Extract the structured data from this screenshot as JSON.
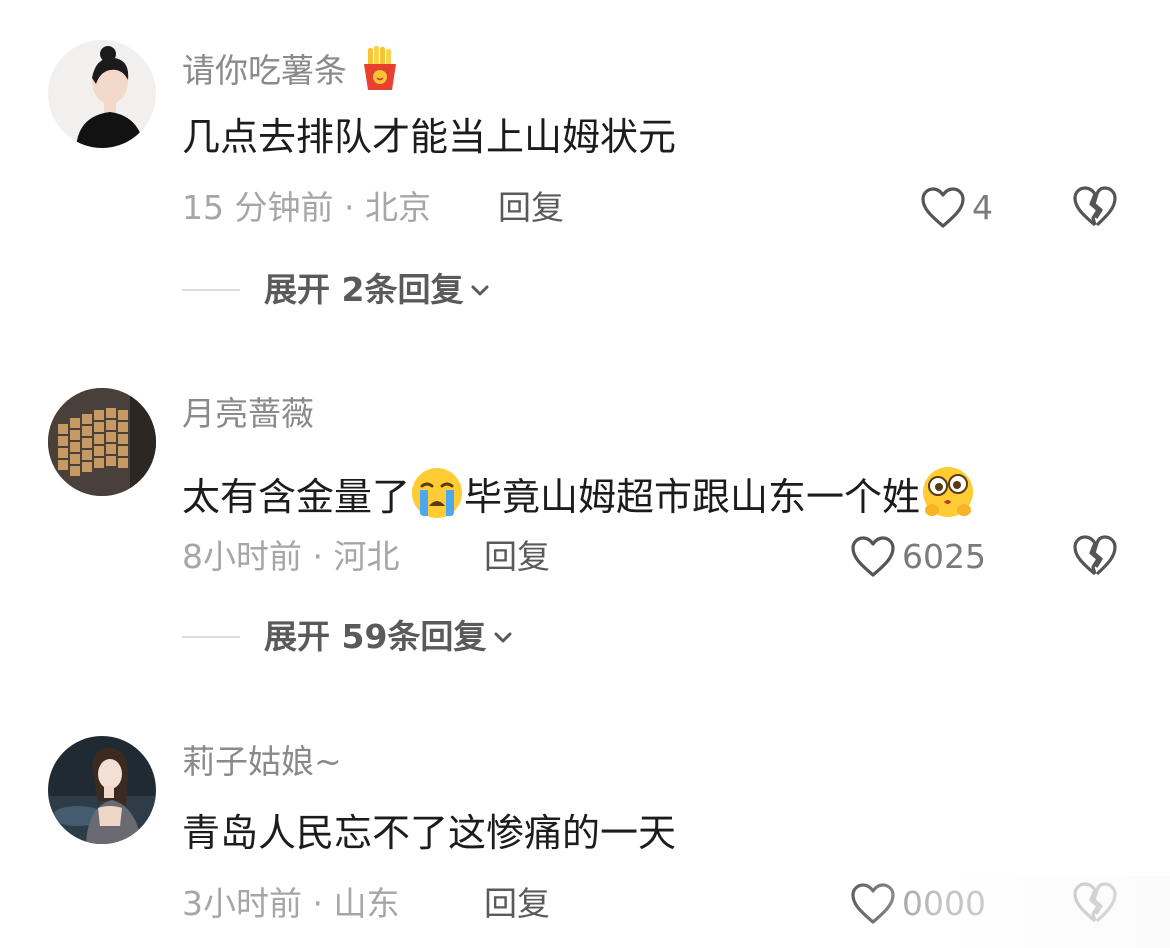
{
  "comments": [
    {
      "username": "请你吃薯条",
      "username_emoji": "fries-icon",
      "text": "几点去排队才能当上山姆状元",
      "time_location": "15 分钟前 · 北京",
      "reply_label": "回复",
      "likes": "4",
      "expand_label": "展开 2条回复"
    },
    {
      "username": "月亮蔷薇",
      "text_part1": "太有含金量了",
      "text_part2": "毕竟山姆超市跟山东一个姓",
      "emoji1": "crying-face-icon",
      "emoji2": "pleading-face-icon",
      "time_location": "8小时前 · 河北",
      "reply_label": "回复",
      "likes": "6025",
      "expand_label": "展开 59条回复"
    },
    {
      "username": "莉子姑娘~",
      "text": "青岛人民忘不了这惨痛的一天",
      "time_location": "3小时前 · 山东",
      "reply_label": "回复",
      "likes": "0000"
    }
  ],
  "colors": {
    "username": "#8a8a8a",
    "content": "#1c1c1c",
    "meta": "#a6a6a6",
    "reply": "#5a5a5a",
    "icon_stroke": "#555555"
  },
  "icons": {
    "like": "heart-outline-icon",
    "dislike": "broken-heart-icon",
    "expand": "chevron-down-icon"
  }
}
